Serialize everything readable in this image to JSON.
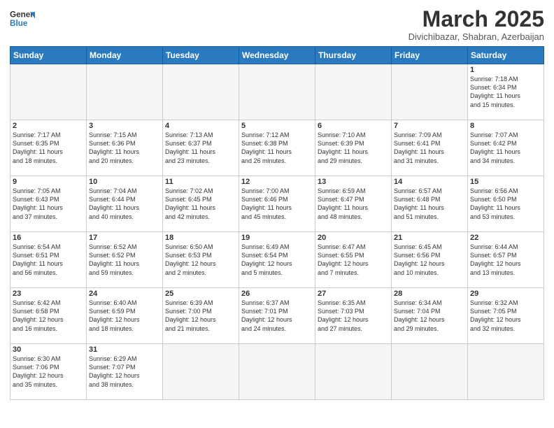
{
  "header": {
    "logo_general": "General",
    "logo_blue": "Blue",
    "month_title": "March 2025",
    "location": "Divichibazar, Shabran, Azerbaijan"
  },
  "days_of_week": [
    "Sunday",
    "Monday",
    "Tuesday",
    "Wednesday",
    "Thursday",
    "Friday",
    "Saturday"
  ],
  "weeks": [
    [
      {
        "num": "",
        "info": ""
      },
      {
        "num": "",
        "info": ""
      },
      {
        "num": "",
        "info": ""
      },
      {
        "num": "",
        "info": ""
      },
      {
        "num": "",
        "info": ""
      },
      {
        "num": "",
        "info": ""
      },
      {
        "num": "1",
        "info": "Sunrise: 7:18 AM\nSunset: 6:34 PM\nDaylight: 11 hours\nand 15 minutes."
      }
    ],
    [
      {
        "num": "2",
        "info": "Sunrise: 7:17 AM\nSunset: 6:35 PM\nDaylight: 11 hours\nand 18 minutes."
      },
      {
        "num": "3",
        "info": "Sunrise: 7:15 AM\nSunset: 6:36 PM\nDaylight: 11 hours\nand 20 minutes."
      },
      {
        "num": "4",
        "info": "Sunrise: 7:13 AM\nSunset: 6:37 PM\nDaylight: 11 hours\nand 23 minutes."
      },
      {
        "num": "5",
        "info": "Sunrise: 7:12 AM\nSunset: 6:38 PM\nDaylight: 11 hours\nand 26 minutes."
      },
      {
        "num": "6",
        "info": "Sunrise: 7:10 AM\nSunset: 6:39 PM\nDaylight: 11 hours\nand 29 minutes."
      },
      {
        "num": "7",
        "info": "Sunrise: 7:09 AM\nSunset: 6:41 PM\nDaylight: 11 hours\nand 31 minutes."
      },
      {
        "num": "8",
        "info": "Sunrise: 7:07 AM\nSunset: 6:42 PM\nDaylight: 11 hours\nand 34 minutes."
      }
    ],
    [
      {
        "num": "9",
        "info": "Sunrise: 7:05 AM\nSunset: 6:43 PM\nDaylight: 11 hours\nand 37 minutes."
      },
      {
        "num": "10",
        "info": "Sunrise: 7:04 AM\nSunset: 6:44 PM\nDaylight: 11 hours\nand 40 minutes."
      },
      {
        "num": "11",
        "info": "Sunrise: 7:02 AM\nSunset: 6:45 PM\nDaylight: 11 hours\nand 42 minutes."
      },
      {
        "num": "12",
        "info": "Sunrise: 7:00 AM\nSunset: 6:46 PM\nDaylight: 11 hours\nand 45 minutes."
      },
      {
        "num": "13",
        "info": "Sunrise: 6:59 AM\nSunset: 6:47 PM\nDaylight: 11 hours\nand 48 minutes."
      },
      {
        "num": "14",
        "info": "Sunrise: 6:57 AM\nSunset: 6:48 PM\nDaylight: 11 hours\nand 51 minutes."
      },
      {
        "num": "15",
        "info": "Sunrise: 6:56 AM\nSunset: 6:50 PM\nDaylight: 11 hours\nand 53 minutes."
      }
    ],
    [
      {
        "num": "16",
        "info": "Sunrise: 6:54 AM\nSunset: 6:51 PM\nDaylight: 11 hours\nand 56 minutes."
      },
      {
        "num": "17",
        "info": "Sunrise: 6:52 AM\nSunset: 6:52 PM\nDaylight: 11 hours\nand 59 minutes."
      },
      {
        "num": "18",
        "info": "Sunrise: 6:50 AM\nSunset: 6:53 PM\nDaylight: 12 hours\nand 2 minutes."
      },
      {
        "num": "19",
        "info": "Sunrise: 6:49 AM\nSunset: 6:54 PM\nDaylight: 12 hours\nand 5 minutes."
      },
      {
        "num": "20",
        "info": "Sunrise: 6:47 AM\nSunset: 6:55 PM\nDaylight: 12 hours\nand 7 minutes."
      },
      {
        "num": "21",
        "info": "Sunrise: 6:45 AM\nSunset: 6:56 PM\nDaylight: 12 hours\nand 10 minutes."
      },
      {
        "num": "22",
        "info": "Sunrise: 6:44 AM\nSunset: 6:57 PM\nDaylight: 12 hours\nand 13 minutes."
      }
    ],
    [
      {
        "num": "23",
        "info": "Sunrise: 6:42 AM\nSunset: 6:58 PM\nDaylight: 12 hours\nand 16 minutes."
      },
      {
        "num": "24",
        "info": "Sunrise: 6:40 AM\nSunset: 6:59 PM\nDaylight: 12 hours\nand 18 minutes."
      },
      {
        "num": "25",
        "info": "Sunrise: 6:39 AM\nSunset: 7:00 PM\nDaylight: 12 hours\nand 21 minutes."
      },
      {
        "num": "26",
        "info": "Sunrise: 6:37 AM\nSunset: 7:01 PM\nDaylight: 12 hours\nand 24 minutes."
      },
      {
        "num": "27",
        "info": "Sunrise: 6:35 AM\nSunset: 7:03 PM\nDaylight: 12 hours\nand 27 minutes."
      },
      {
        "num": "28",
        "info": "Sunrise: 6:34 AM\nSunset: 7:04 PM\nDaylight: 12 hours\nand 29 minutes."
      },
      {
        "num": "29",
        "info": "Sunrise: 6:32 AM\nSunset: 7:05 PM\nDaylight: 12 hours\nand 32 minutes."
      }
    ],
    [
      {
        "num": "30",
        "info": "Sunrise: 6:30 AM\nSunset: 7:06 PM\nDaylight: 12 hours\nand 35 minutes."
      },
      {
        "num": "31",
        "info": "Sunrise: 6:29 AM\nSunset: 7:07 PM\nDaylight: 12 hours\nand 38 minutes."
      },
      {
        "num": "",
        "info": ""
      },
      {
        "num": "",
        "info": ""
      },
      {
        "num": "",
        "info": ""
      },
      {
        "num": "",
        "info": ""
      },
      {
        "num": "",
        "info": ""
      }
    ]
  ]
}
